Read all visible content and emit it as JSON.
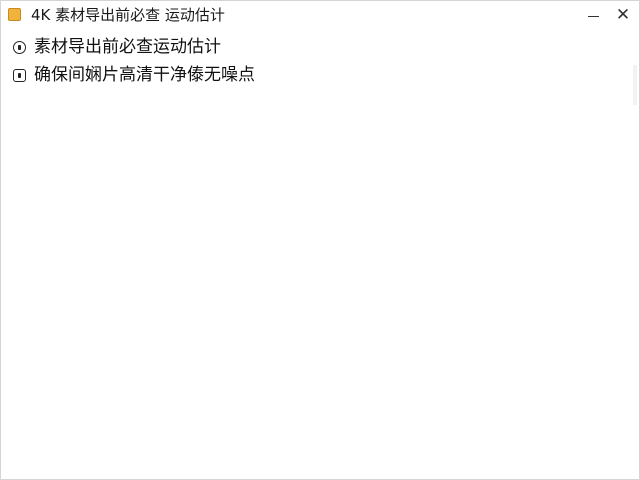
{
  "window": {
    "title": "4K 素材导出前必查 运动估计",
    "icon": "folder-icon",
    "minimize_label": "",
    "close_label": "✕"
  },
  "list": {
    "items": [
      {
        "icon": "clock-icon",
        "label": "素材导出前必查运动估计"
      },
      {
        "icon": "checkbox-icon",
        "label": "确保间娴片高清干净傣无噪点"
      }
    ]
  },
  "colors": {
    "app_icon": "#f2b33c",
    "text": "#111111",
    "background": "#ffffff"
  }
}
